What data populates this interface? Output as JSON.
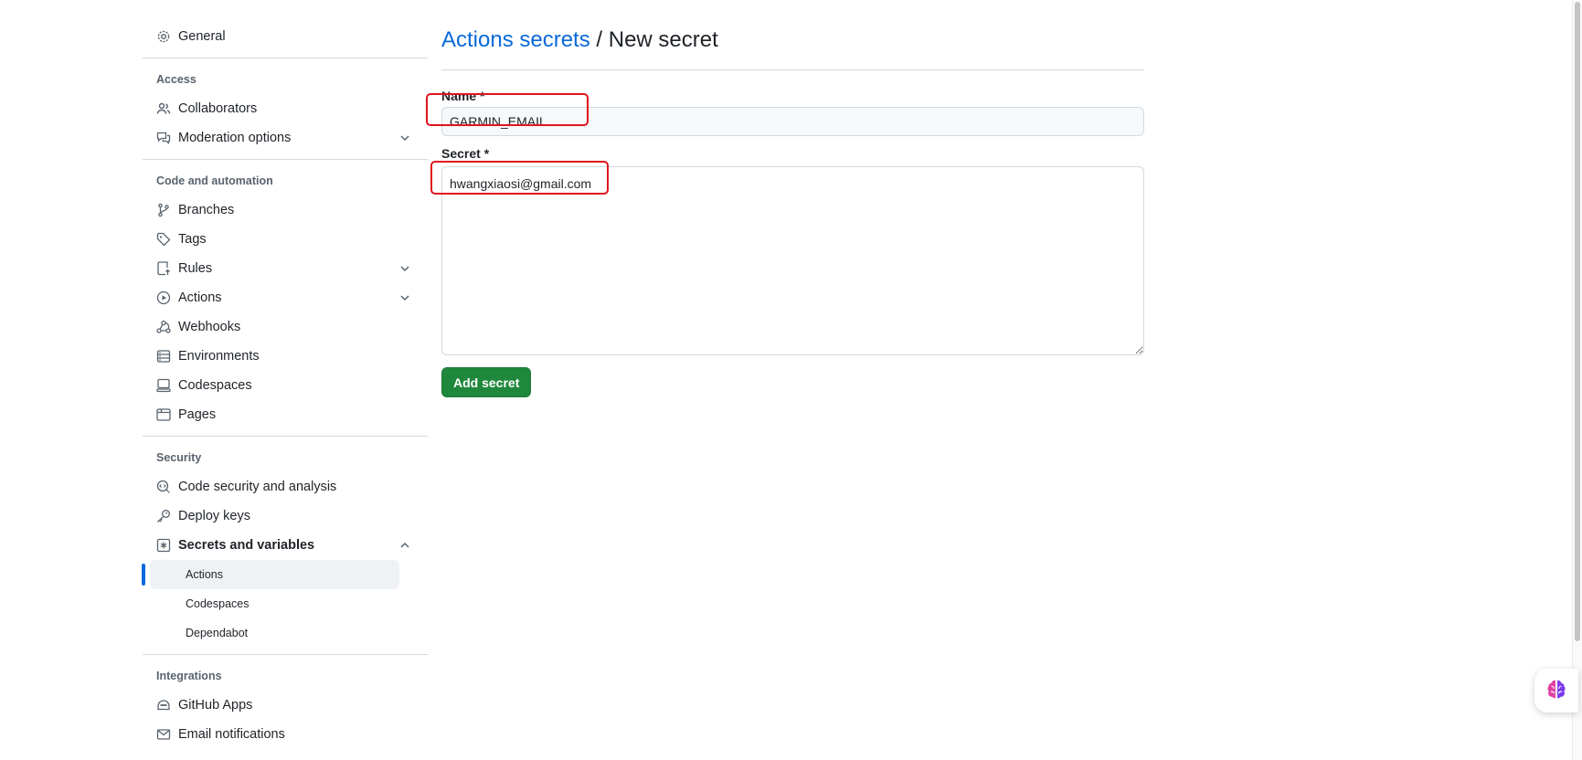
{
  "sidebar": {
    "general": "General",
    "access_heading": "Access",
    "collaborators": "Collaborators",
    "moderation": "Moderation options",
    "code_heading": "Code and automation",
    "branches": "Branches",
    "tags": "Tags",
    "rules": "Rules",
    "actions": "Actions",
    "webhooks": "Webhooks",
    "environments": "Environments",
    "codespaces": "Codespaces",
    "pages": "Pages",
    "security_heading": "Security",
    "code_security": "Code security and analysis",
    "deploy_keys": "Deploy keys",
    "secrets": "Secrets and variables",
    "secrets_sub": {
      "actions": "Actions",
      "codespaces": "Codespaces",
      "dependabot": "Dependabot"
    },
    "integrations_heading": "Integrations",
    "github_apps": "GitHub Apps",
    "email_notifications": "Email notifications"
  },
  "main": {
    "breadcrumb_link": "Actions secrets",
    "separator": " / ",
    "title": "New secret",
    "name_label": "Name *",
    "name_value": "GARMIN_EMAIL",
    "secret_label": "Secret *",
    "secret_value": "hwangxiaosi@gmail.com",
    "submit_label": "Add secret"
  },
  "colors": {
    "link": "#0969da",
    "primary_button": "#1f883d",
    "highlight": "#e0141e"
  }
}
